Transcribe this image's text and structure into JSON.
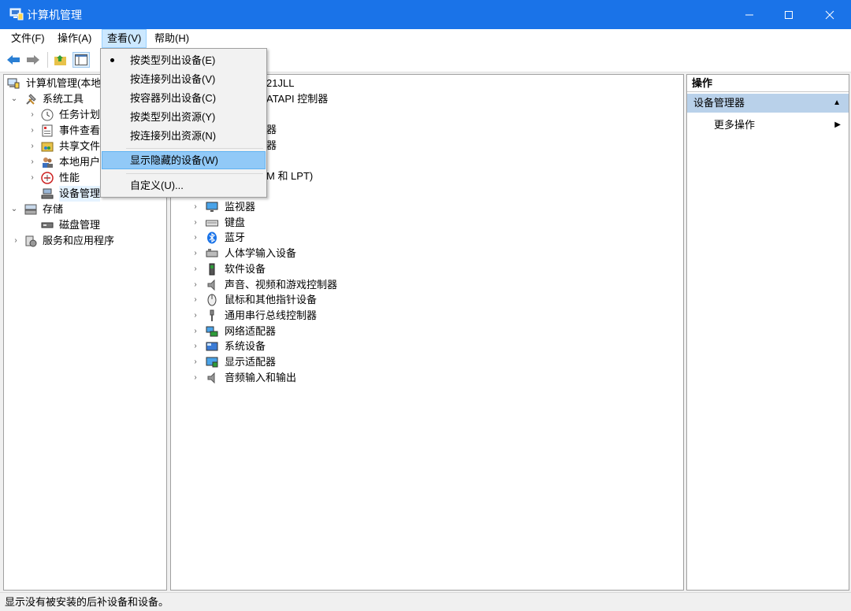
{
  "window": {
    "title": "计算机管理",
    "accent_color": "#1a73e8"
  },
  "menubar": {
    "items": [
      "文件(F)",
      "操作(A)",
      "查看(V)",
      "帮助(H)"
    ]
  },
  "left_tree": {
    "root": "计算机管理(本地",
    "system_tools": "系统工具",
    "task_scheduler": "任务计划",
    "event_viewer": "事件查看",
    "shared_folders": "共享文件",
    "local_users": "本地用户",
    "performance": "性能",
    "device_manager": "设备管理",
    "storage": "存储",
    "disk_mgmt": "磁盘管理",
    "services": "服务和应用程序"
  },
  "device_tree": {
    "partial_top": [
      "21JLL",
      "ATAPI 控制器",
      "器",
      "器",
      "M 和 LPT)"
    ],
    "items": [
      {
        "label": "监视器",
        "icon": "monitor-icon"
      },
      {
        "label": "键盘",
        "icon": "keyboard-icon"
      },
      {
        "label": "蓝牙",
        "icon": "bluetooth-icon"
      },
      {
        "label": "人体学输入设备",
        "icon": "hid-icon"
      },
      {
        "label": "软件设备",
        "icon": "software-device-icon"
      },
      {
        "label": "声音、视频和游戏控制器",
        "icon": "speaker-icon"
      },
      {
        "label": "鼠标和其他指针设备",
        "icon": "mouse-icon"
      },
      {
        "label": "通用串行总线控制器",
        "icon": "usb-icon"
      },
      {
        "label": "网络适配器",
        "icon": "network-icon"
      },
      {
        "label": "系统设备",
        "icon": "system-device-icon"
      },
      {
        "label": "显示适配器",
        "icon": "display-adapter-icon"
      },
      {
        "label": "音频输入和输出",
        "icon": "audio-io-icon"
      }
    ]
  },
  "view_menu": {
    "items": [
      {
        "label": "按类型列出设备(E)",
        "checked": true
      },
      {
        "label": "按连接列出设备(V)",
        "checked": false
      },
      {
        "label": "按容器列出设备(C)",
        "checked": false
      },
      {
        "label": "按类型列出资源(Y)",
        "checked": false
      },
      {
        "label": "按连接列出资源(N)",
        "checked": false
      },
      {
        "label": "显示隐藏的设备(W)",
        "checked": false,
        "highlighted": true
      },
      {
        "label": "自定义(U)...",
        "checked": false
      }
    ]
  },
  "actions": {
    "header": "操作",
    "group": "设备管理器",
    "more": "更多操作"
  },
  "status": {
    "text": "显示没有被安装的后补设备和设备。"
  }
}
